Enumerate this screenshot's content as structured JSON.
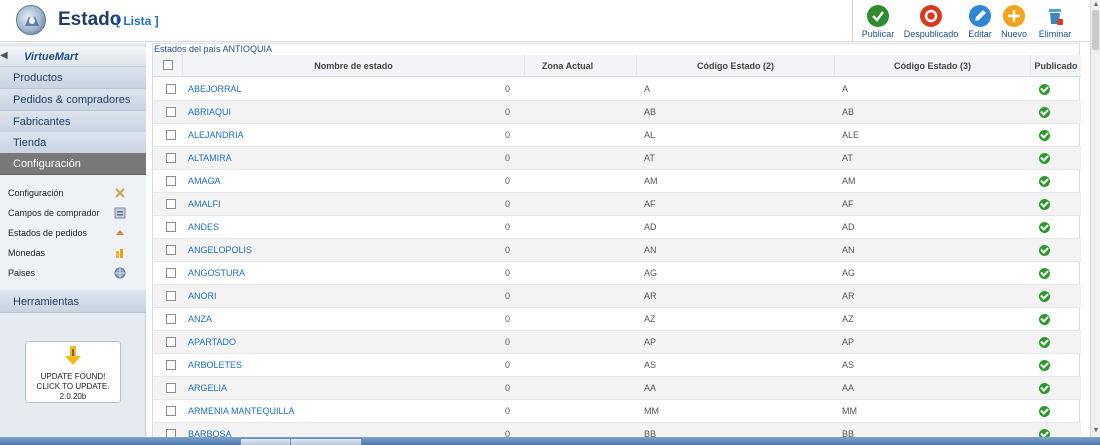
{
  "header": {
    "title": "Estado",
    "subtitle": "[ Lista ]"
  },
  "toolbar": {
    "publish_label": "Publicar",
    "unpublish_label": "Despublicado",
    "edit_label": "Editar",
    "new_label": "Nuevo",
    "delete_label": "Eliminar"
  },
  "sidebar": {
    "brand": "VirtueMart",
    "menu": [
      {
        "label": "Productos"
      },
      {
        "label": "Pedidos & compradores"
      },
      {
        "label": "Fabricantes"
      },
      {
        "label": "Tienda"
      },
      {
        "label": "Configuración"
      }
    ],
    "submenu": [
      {
        "label": "Configuración"
      },
      {
        "label": "Campos de comprador"
      },
      {
        "label": "Estados de pedidos"
      },
      {
        "label": "Monedas"
      },
      {
        "label": "Paises"
      }
    ],
    "tools_label": "Herramientas",
    "update": {
      "line1": "UPDATE FOUND!",
      "line2": "CLICK TO UPDATE.",
      "line3": "2.0.20b"
    }
  },
  "list": {
    "caption": "Estados del país ANTIOQUIA",
    "columns": [
      "Nombre de estado",
      "Zona Actual",
      "Código Estado (2)",
      "Código Estado (3)",
      "Publicado"
    ],
    "rows": [
      {
        "name": "ABEJORRAL",
        "zone": "0",
        "code2": "A",
        "code3": "A"
      },
      {
        "name": "ABRIAQUI",
        "zone": "0",
        "code2": "AB",
        "code3": "AB"
      },
      {
        "name": "ALEJANDRIA",
        "zone": "0",
        "code2": "AL",
        "code3": "ALE"
      },
      {
        "name": "ALTAMIRA",
        "zone": "0",
        "code2": "AT",
        "code3": "AT"
      },
      {
        "name": "AMAGA",
        "zone": "0",
        "code2": "AM",
        "code3": "AM"
      },
      {
        "name": "AMALFI",
        "zone": "0",
        "code2": "AF",
        "code3": "AF"
      },
      {
        "name": "ANDES",
        "zone": "0",
        "code2": "AD",
        "code3": "AD"
      },
      {
        "name": "ANGELOPOLIS",
        "zone": "0",
        "code2": "AN",
        "code3": "AN"
      },
      {
        "name": "ANGOSTURA",
        "zone": "0",
        "code2": "AG",
        "code3": "AG"
      },
      {
        "name": "ANORI",
        "zone": "0",
        "code2": "AR",
        "code3": "AR"
      },
      {
        "name": "ANZA",
        "zone": "0",
        "code2": "AZ",
        "code3": "AZ"
      },
      {
        "name": "APARTADO",
        "zone": "0",
        "code2": "AP",
        "code3": "AP"
      },
      {
        "name": "ARBOLETES",
        "zone": "0",
        "code2": "AS",
        "code3": "AS"
      },
      {
        "name": "ARGELIA",
        "zone": "0",
        "code2": "AA",
        "code3": "AA"
      },
      {
        "name": "ARMENIA MANTEQUILLA",
        "zone": "0",
        "code2": "MM",
        "code3": "MM"
      },
      {
        "name": "BARBOSA",
        "zone": "0",
        "code2": "BB",
        "code3": "BB"
      }
    ]
  },
  "colors": {
    "accent": "#1f6fb8",
    "title": "#1f3e66",
    "active_menu": "#787878",
    "published": "#2e9a2e"
  }
}
